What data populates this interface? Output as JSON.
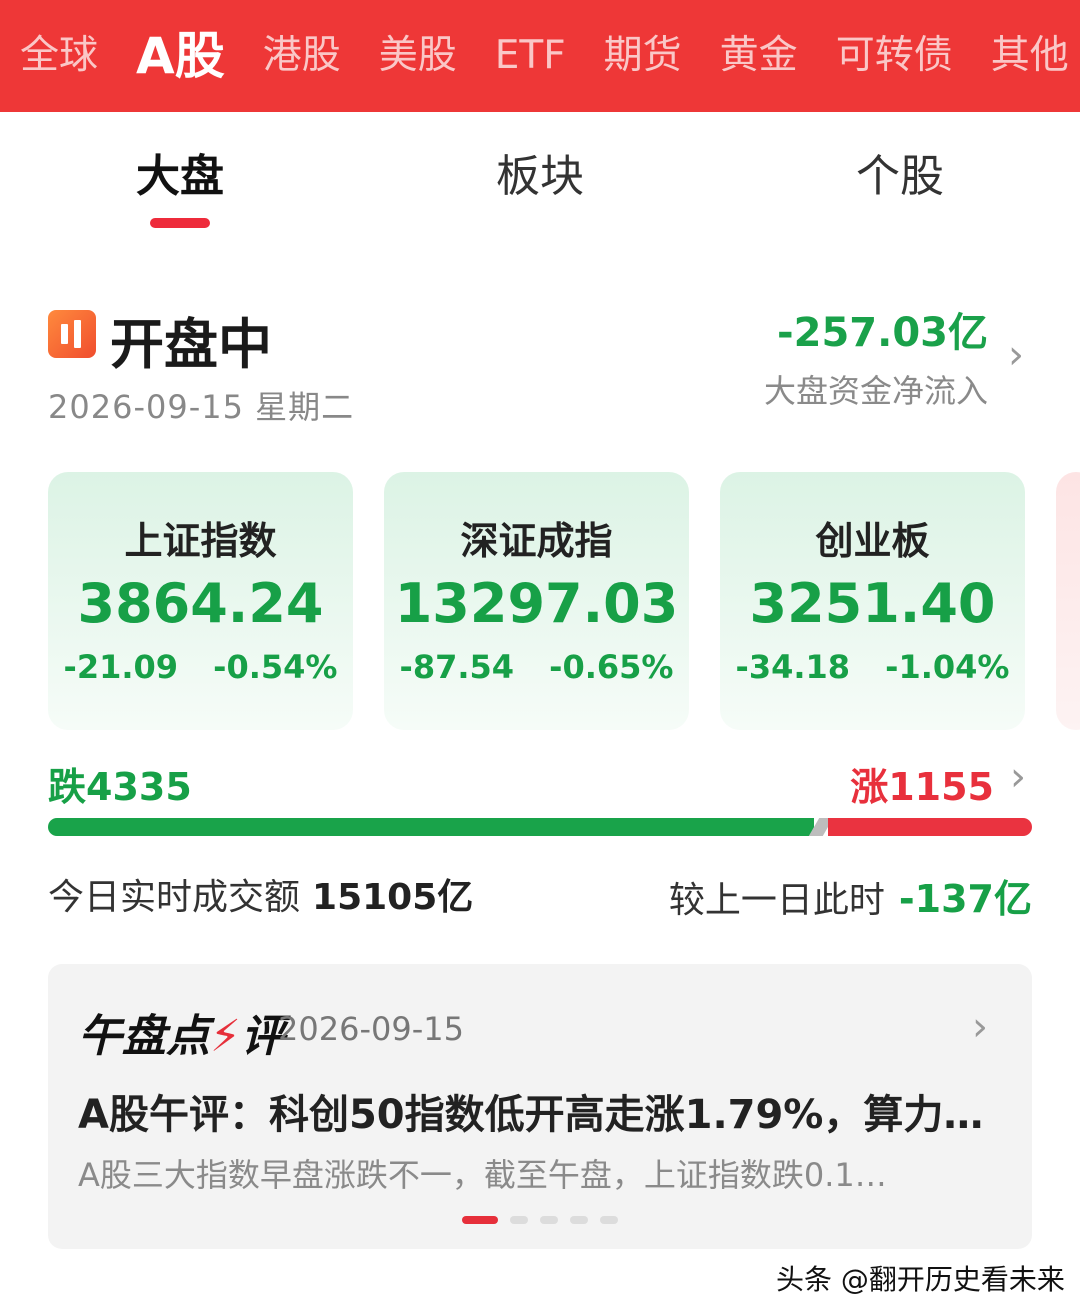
{
  "top_tabs": [
    {
      "label": "全球"
    },
    {
      "label": "A股"
    },
    {
      "label": "港股"
    },
    {
      "label": "美股"
    },
    {
      "label": "ETF"
    },
    {
      "label": "期货"
    },
    {
      "label": "黄金"
    },
    {
      "label": "可转债"
    },
    {
      "label": "其他"
    }
  ],
  "sub_tabs": [
    {
      "label": "大盘"
    },
    {
      "label": "板块"
    },
    {
      "label": "个股"
    }
  ],
  "status": {
    "title": "开盘中",
    "date": "2026-09-15 星期二",
    "net_flow_value": "-257.03亿",
    "net_flow_label": "大盘资金净流入"
  },
  "indices": [
    {
      "name": "上证指数",
      "value": "3864.24",
      "change": "-21.09",
      "pct": "-0.54%"
    },
    {
      "name": "深证成指",
      "value": "13297.03",
      "change": "-87.54",
      "pct": "-0.65%"
    },
    {
      "name": "创业板",
      "value": "3251.40",
      "change": "-34.18",
      "pct": "-1.04%"
    }
  ],
  "breadth": {
    "fall_label": "跌4335",
    "rise_label": "涨1155",
    "fall": 4335,
    "rise": 1155
  },
  "turnover": {
    "label": "今日实时成交额",
    "value": "15105亿",
    "compare_label": "较上一日此时",
    "compare_value": "-137亿"
  },
  "commentary": {
    "logo": "午盘点评",
    "date": "2026-09-15",
    "headline": "A股午评：科创50指数低开高走涨1.79%，算力…",
    "summary": "A股三大指数早盘涨跌不一，截至午盘，上证指数跌0.1…",
    "page_count": 5,
    "active_page": 1
  },
  "watermark": "头条 @翻开历史看未来",
  "colors": {
    "brand_red": "#ee3737",
    "up_red": "#ea3340",
    "down_green": "#17a047"
  }
}
